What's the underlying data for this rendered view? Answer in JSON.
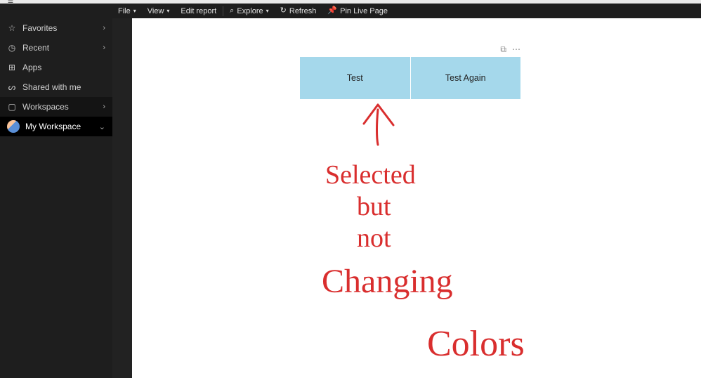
{
  "toolbar": {
    "file": "File",
    "view": "View",
    "edit_report": "Edit report",
    "explore": "Explore",
    "refresh": "Refresh",
    "pin_live": "Pin Live Page"
  },
  "sidebar": {
    "favorites": "Favorites",
    "recent": "Recent",
    "apps": "Apps",
    "shared": "Shared with me",
    "workspaces": "Workspaces",
    "my_workspace": "My Workspace"
  },
  "slicer": {
    "option1": "Test",
    "option2": "Test Again"
  },
  "annotation": {
    "text": "Selected but not Changing Colors",
    "color": "#d92e2e"
  }
}
